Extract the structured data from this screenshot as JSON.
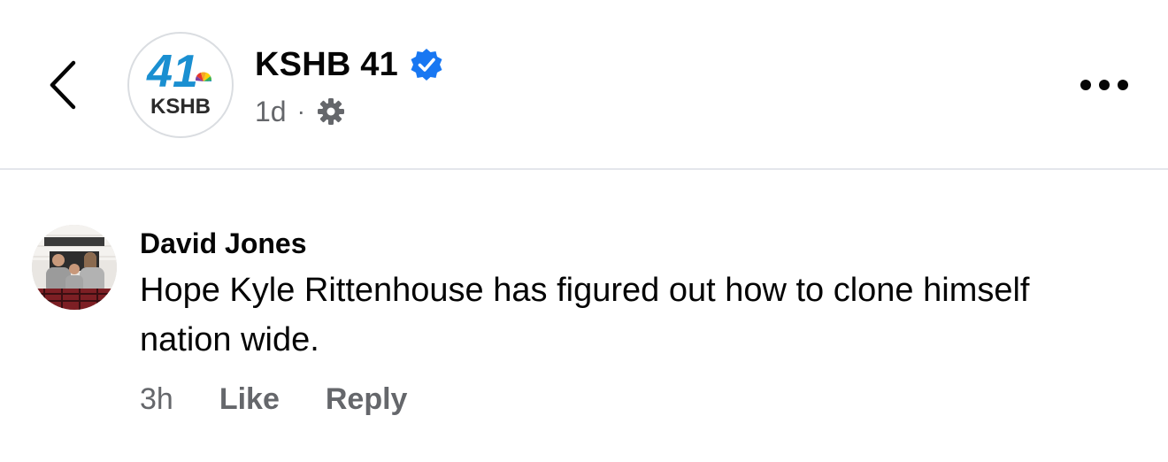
{
  "header": {
    "page_name": "KSHB 41",
    "time_ago": "1d",
    "separator": "·",
    "logo_number": "41",
    "logo_text": "KSHB"
  },
  "comment": {
    "author": "David Jones",
    "text": "Hope Kyle Rittenhouse has figured out how to clone himself nation wide.",
    "time_ago": "3h",
    "like_label": "Like",
    "reply_label": "Reply"
  },
  "colors": {
    "verified_blue": "#1877f2",
    "logo_blue": "#1a8fd1",
    "secondary_text": "#65676b"
  },
  "icons": {
    "back": "chevron-left-icon",
    "verified": "verified-badge-icon",
    "audience": "gear-icon",
    "more": "more-horizontal-icon"
  }
}
